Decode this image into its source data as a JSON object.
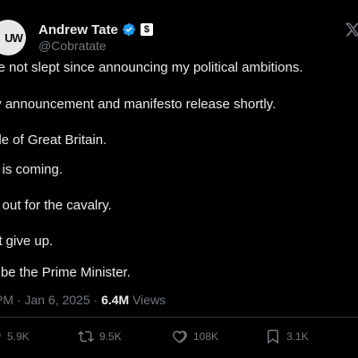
{
  "author": {
    "display_name": "Andrew Tate",
    "handle": "@Cobratate",
    "avatar_text": "UW",
    "affiliation_badge": "$"
  },
  "tweet_lines": [
    "ve not slept since announcing my political ambitions.",
    "ty announcement and manifesto release shortly.",
    "ple of Great Britain.",
    "p is coming.",
    "d out for the cavalry.",
    "nt give up.",
    "ll be the Prime Minister."
  ],
  "meta": {
    "time_fragment": "PM",
    "separator": "·",
    "date": "Jan 6, 2025",
    "views_count": "6.4M",
    "views_label": "Views"
  },
  "actions": {
    "replies": "5.9K",
    "reposts": "9.5K",
    "likes": "108K",
    "bookmarks": "3.1K"
  },
  "colors": {
    "background": "#000000",
    "text": "#e7e9ea",
    "muted": "#71767b",
    "verified_badge": "#1d9bf0"
  },
  "icons": [
    "verified-badge-icon",
    "affiliation-badge-icon",
    "x-logo-icon",
    "reply-icon",
    "repost-icon",
    "like-icon",
    "bookmark-icon"
  ]
}
